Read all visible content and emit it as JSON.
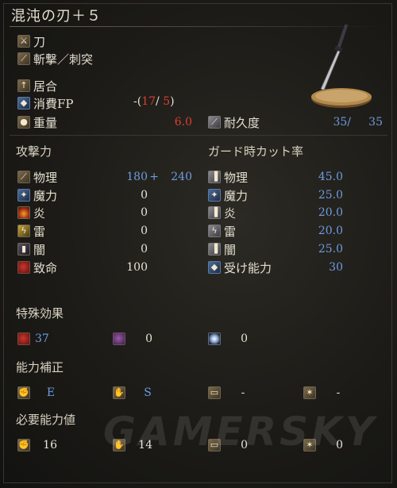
{
  "weapon": {
    "name": "混沌の刃＋５",
    "category": "刀",
    "attack_type": "斬撃／刺突",
    "skill": "居合",
    "fp_label": "消費FP",
    "fp_prefix": "-",
    "fp_open": "(",
    "fp_value1": "17",
    "fp_slash": "/",
    "fp_value2": "5",
    "fp_close": ")",
    "weight_label": "重量",
    "weight_value": "6.0",
    "durability_label": "耐久度",
    "durability_current": "35/",
    "durability_max": "35"
  },
  "attack": {
    "title": "攻撃力",
    "physical_label": "物理",
    "physical_base": "180",
    "physical_plus": "+",
    "physical_bonus": "240",
    "magic_label": "魔力",
    "magic_value": "0",
    "fire_label": "炎",
    "fire_value": "0",
    "lightning_label": "雷",
    "lightning_value": "0",
    "dark_label": "闇",
    "dark_value": "0",
    "critical_label": "致命",
    "critical_value": "100"
  },
  "guard": {
    "title": "ガード時カット率",
    "physical_label": "物理",
    "physical_value": "45.0",
    "magic_label": "魔力",
    "magic_value": "25.0",
    "fire_label": "炎",
    "fire_value": "20.0",
    "lightning_label": "雷",
    "lightning_value": "20.0",
    "dark_label": "闇",
    "dark_value": "25.0",
    "stability_label": "受け能力",
    "stability_value": "30"
  },
  "special": {
    "title": "特殊効果",
    "bleed_value": "37",
    "poison_value": "0",
    "frost_value": "0"
  },
  "scaling": {
    "title": "能力補正",
    "str": "E",
    "dex": "S",
    "int": "-",
    "fth": "-"
  },
  "requirements": {
    "title": "必要能力値",
    "str": "16",
    "dex": "14",
    "int": "0",
    "fth": "0"
  },
  "watermark": "GAMERSKY"
}
